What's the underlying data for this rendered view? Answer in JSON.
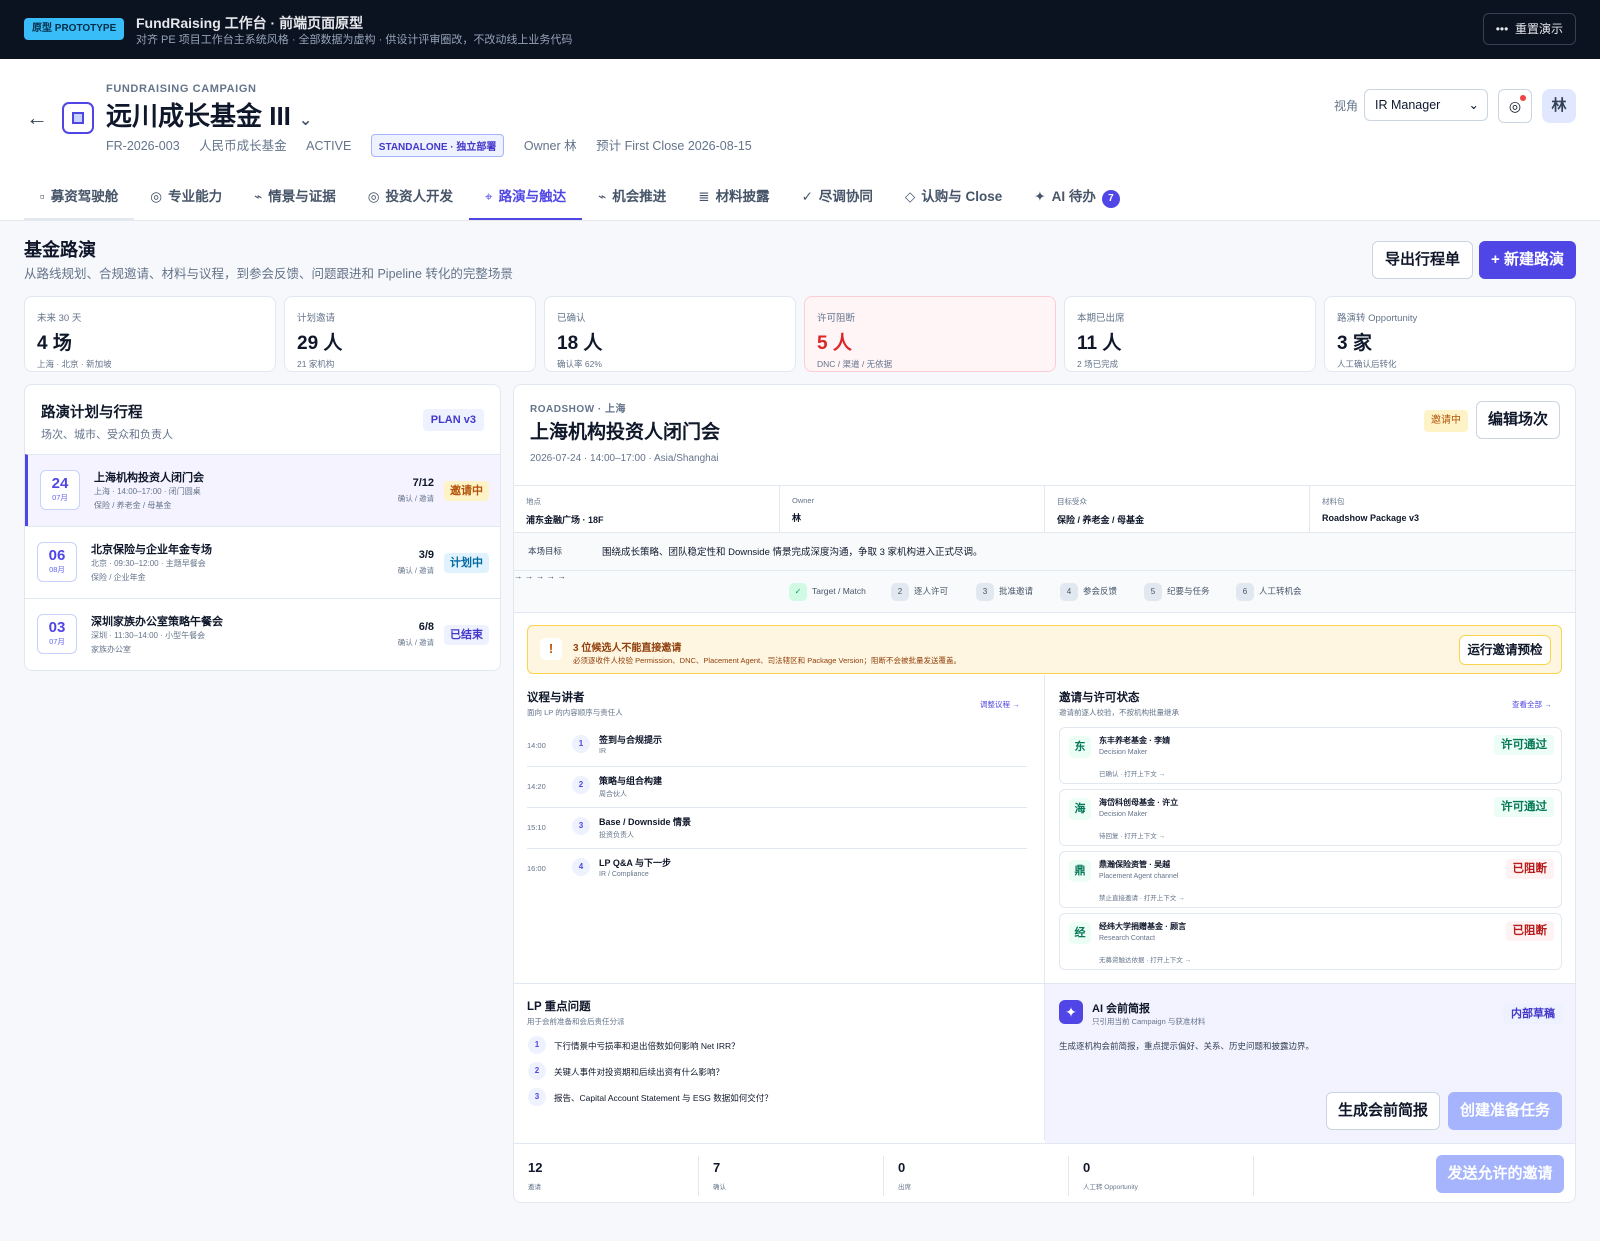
{
  "topbar": {
    "badge": "原型 PROTOTYPE",
    "title": "FundRaising 工作台 · 前端页面原型",
    "subtitle": "对齐 PE 项目工作台主系统风格 · 全部数据为虚构 · 供设计评审圈改，不改动线上业务代码",
    "reset_label": "重置演示",
    "reset_icon": "•••"
  },
  "header": {
    "back_icon": "←",
    "eyebrow": "FUNDRAISING CAMPAIGN",
    "title": "远川成长基金 III",
    "caret": "⌄",
    "code": "FR-2026-003",
    "fund_type": "人民币成长基金",
    "status": "ACTIVE",
    "deploy_tag": "STANDALONE · 独立部署",
    "owner": "Owner 林",
    "first_close": "预计 First Close 2026-08-15",
    "view_label": "视角",
    "view_value": "IR Manager",
    "view_caret": "⌄",
    "notif_icon": "◎",
    "avatar": "林"
  },
  "tabs": [
    {
      "icon": "▫",
      "label": "募资驾驶舱"
    },
    {
      "icon": "◎",
      "label": "专业能力"
    },
    {
      "icon": "⌁",
      "label": "情景与证据"
    },
    {
      "icon": "◎",
      "label": "投资人开发"
    },
    {
      "icon": "⌖",
      "label": "路演与触达"
    },
    {
      "icon": "⌁",
      "label": "机会推进"
    },
    {
      "icon": "≣",
      "label": "材料披露"
    },
    {
      "icon": "✓",
      "label": "尽调协同"
    },
    {
      "icon": "◇",
      "label": "认购与 Close"
    },
    {
      "icon": "✦",
      "label": "AI 待办",
      "count": "7"
    }
  ],
  "page": {
    "title": "基金路演",
    "subtitle": "从路线规划、合规邀请、材料与议程，到参会反馈、问题跟进和 Pipeline 转化的完整场景",
    "export_label": "导出行程单",
    "new_label": "+ 新建路演"
  },
  "kpis": [
    {
      "label": "未来 30 天",
      "value": "4 场",
      "sub": "上海 · 北京 · 新加坡"
    },
    {
      "label": "计划邀请",
      "value": "29 人",
      "sub": "21 家机构"
    },
    {
      "label": "已确认",
      "value": "18 人",
      "sub": "确认率 62%"
    },
    {
      "label": "许可阻断",
      "value": "5 人",
      "sub": "DNC / 渠道 / 无依据"
    },
    {
      "label": "本期已出席",
      "value": "11 人",
      "sub": "2 场已完成"
    },
    {
      "label": "路演转 Opportunity",
      "value": "3 家",
      "sub": "人工确认后转化"
    }
  ],
  "plan": {
    "title": "路演计划与行程",
    "subtitle": "场次、城市、受众和负责人",
    "tag": "PLAN v3",
    "rows": [
      {
        "day": "24",
        "month": "07月",
        "name": "上海机构投资人闭门会",
        "meta": "上海 · 14:00–17:00 · 闭门圆桌",
        "audience": "保险 / 养老金 / 母基金",
        "count": "7/12",
        "count_label": "确认 / 邀请",
        "status": "邀请中"
      },
      {
        "day": "06",
        "month": "08月",
        "name": "北京保险与企业年金专场",
        "meta": "北京 · 09:30–12:00 · 主题早餐会",
        "audience": "保险 / 企业年金",
        "count": "3/9",
        "count_label": "确认 / 邀请",
        "status": "计划中"
      },
      {
        "day": "03",
        "month": "07月",
        "name": "深圳家族办公室策略午餐会",
        "meta": "深圳 · 11:30–14:00 · 小型午餐会",
        "audience": "家族办公室",
        "count": "6/8",
        "count_label": "确认 / 邀请",
        "status": "已结束"
      }
    ]
  },
  "detail": {
    "eyebrow": "ROADSHOW · 上海",
    "title": "上海机构投资人闭门会",
    "time": "2026-07-24 · 14:00–17:00 · Asia/Shanghai",
    "status": "邀请中",
    "edit_label": "编辑场次",
    "info": [
      {
        "label": "地点",
        "value": "浦东金融广场 · 18F"
      },
      {
        "label": "Owner",
        "value": "林"
      },
      {
        "label": "目标受众",
        "value": "保险 / 养老金 / 母基金"
      },
      {
        "label": "材料包",
        "value": "Roadshow Package v3"
      }
    ],
    "goal_label": "本场目标",
    "goal": "围绕成长策略、团队稳定性和 Downside 情景完成深度沟通，争取 3 家机构进入正式尽调。",
    "steps": [
      {
        "n": "✓",
        "label": "Target / Match"
      },
      {
        "n": "2",
        "label": "逐人许可"
      },
      {
        "n": "3",
        "label": "批准邀请"
      },
      {
        "n": "4",
        "label": "参会反馈"
      },
      {
        "n": "5",
        "label": "纪要与任务"
      },
      {
        "n": "6",
        "label": "人工转机会"
      }
    ],
    "step_arrow": "→",
    "alert": {
      "icon": "!",
      "title": "3 位候选人不能直接邀请",
      "sub": "必须逐收件人校验 Permission、DNC、Placement Agent、司法辖区和 Package Version；阻断不会被批量发送覆盖。",
      "button": "运行邀请预检"
    },
    "agenda": {
      "title": "议程与讲者",
      "subtitle": "面向 LP 的内容顺序与责任人",
      "link": "调整议程 →",
      "items": [
        {
          "time": "14:00",
          "n": "1",
          "title": "签到与合规提示",
          "owner": "IR"
        },
        {
          "time": "14:20",
          "n": "2",
          "title": "策略与组合构建",
          "owner": "周合伙人"
        },
        {
          "time": "15:10",
          "n": "3",
          "title": "Base / Downside 情景",
          "owner": "投资负责人"
        },
        {
          "time": "16:00",
          "n": "4",
          "title": "LP Q&A 与下一步",
          "owner": "IR / Compliance"
        }
      ]
    },
    "invites": {
      "title": "邀请与许可状态",
      "subtitle": "邀请前逐人校验，不按机构批量继承",
      "link": "查看全部 →",
      "items": [
        {
          "avatar": "东",
          "name": "东丰养老基金 · 李婧",
          "role": "Decision Maker",
          "context": "已确认 · 打开上下文 →",
          "status": "许可通过"
        },
        {
          "avatar": "海",
          "name": "海岱科创母基金 · 许立",
          "role": "Decision Maker",
          "context": "待回复 · 打开上下文 →",
          "status": "许可通过"
        },
        {
          "avatar": "鼎",
          "name": "鼎瀚保险资管 · 吴越",
          "role": "Placement Agent channel",
          "context": "禁止直接邀请 · 打开上下文 →",
          "status": "已阻断"
        },
        {
          "avatar": "经",
          "name": "经纬大学捐赠基金 · 顾言",
          "role": "Research Contact",
          "context": "无募资触达依据 · 打开上下文 →",
          "status": "已阻断"
        }
      ]
    },
    "questions": {
      "title": "LP 重点问题",
      "subtitle": "用于会前准备和会后责任分派",
      "items": [
        {
          "n": "1",
          "text": "下行情景中亏损率和退出倍数如何影响 Net IRR？"
        },
        {
          "n": "2",
          "text": "关键人事件对投资期和后续出资有什么影响？"
        },
        {
          "n": "3",
          "text": "报告、Capital Account Statement 与 ESG 数据如何交付？"
        }
      ]
    },
    "ai": {
      "icon": "✦",
      "title": "AI 会前简报",
      "subtitle": "只引用当前 Campaign 与获准材料",
      "tag": "内部草稿",
      "desc": "生成逐机构会前简报，重点提示偏好、关系、历史问题和披露边界。",
      "btn_generate": "生成会前简报",
      "btn_task": "创建准备任务"
    },
    "footer": {
      "stats": [
        {
          "value": "12",
          "label": "邀请"
        },
        {
          "value": "7",
          "label": "确认"
        },
        {
          "value": "0",
          "label": "出席"
        },
        {
          "value": "0",
          "label": "人工转 Opportunity"
        }
      ],
      "send_label": "发送允许的邀请"
    }
  },
  "colors": {
    "accent": "#4f46e5",
    "danger": "#dc2626",
    "warning": "#b45309",
    "success": "#047857"
  }
}
